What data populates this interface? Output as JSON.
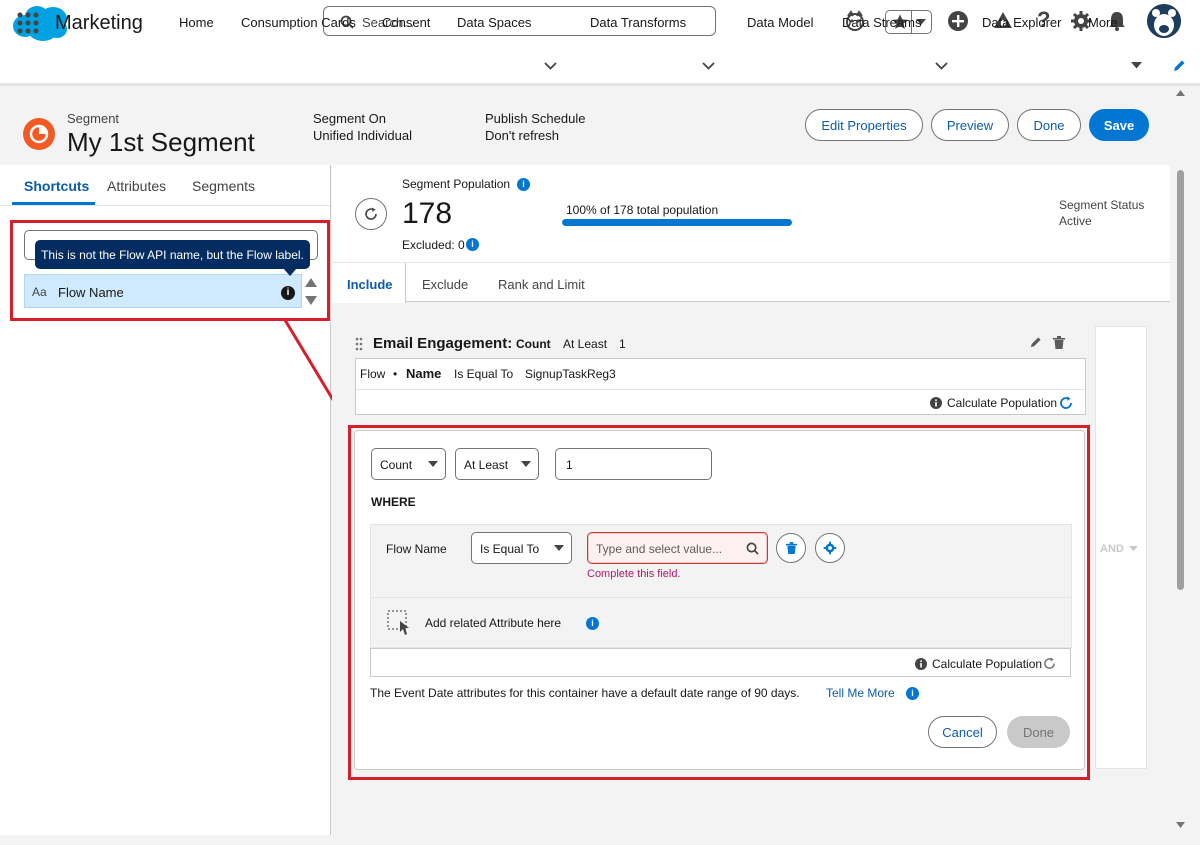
{
  "topbar": {
    "search_placeholder": "Search..."
  },
  "nav": {
    "app_name": "Marketing",
    "items": [
      "Home",
      "Consumption Cards",
      "Consent",
      "Data Spaces",
      "Data Transforms",
      "Data Model",
      "Data Streams",
      "Data Explorer",
      "More"
    ]
  },
  "header": {
    "object_type": "Segment",
    "title": "My 1st Segment",
    "segment_on_label": "Segment On",
    "segment_on_value": "Unified Individual",
    "publish_label": "Publish Schedule",
    "publish_value": "Don't refresh",
    "buttons": {
      "edit": "Edit Properties",
      "preview": "Preview",
      "done": "Done",
      "save": "Save"
    }
  },
  "left_panel": {
    "tabs": [
      "Shortcuts",
      "Attributes",
      "Segments"
    ],
    "active_tab": "Shortcuts",
    "tooltip": "This is not the Flow API name, but the Flow label.",
    "type_icon": "Aa",
    "item_label": "Flow Name"
  },
  "population": {
    "label": "Segment Population",
    "value": "178",
    "excluded": "Excluded: 0",
    "progress_text": "100% of 178 total population",
    "progress_percent": 100,
    "status_label": "Segment Status",
    "status_value": "Active"
  },
  "main_tabs": [
    "Include",
    "Exclude",
    "Rank and Limit"
  ],
  "container": {
    "title": "Email Engagement:",
    "aggregate": "Count",
    "operator": "At Least",
    "value": "1",
    "criteria": {
      "object": "Flow",
      "bullet": "•",
      "field": "Name",
      "operator": "Is Equal To",
      "value": "SignupTaskReg3"
    },
    "calculate_label": "Calculate Population"
  },
  "editor": {
    "aggregate": "Count",
    "operator": "At Least",
    "value": "1",
    "where_label": "WHERE",
    "field_label": "Flow Name",
    "condition_operator": "Is Equal To",
    "value_placeholder": "Type and select value...",
    "error_text": "Complete this field.",
    "add_related": "Add related Attribute here",
    "calculate_label": "Calculate Population",
    "note": "The Event Date attributes for this container have a default date range of 90 days.",
    "note_link": "Tell Me More",
    "cancel": "Cancel",
    "done": "Done"
  },
  "and_label": "AND",
  "colors": {
    "brand": "#0176d3",
    "highlight_red": "#d61f2c",
    "segment_icon": "#f15a24"
  }
}
